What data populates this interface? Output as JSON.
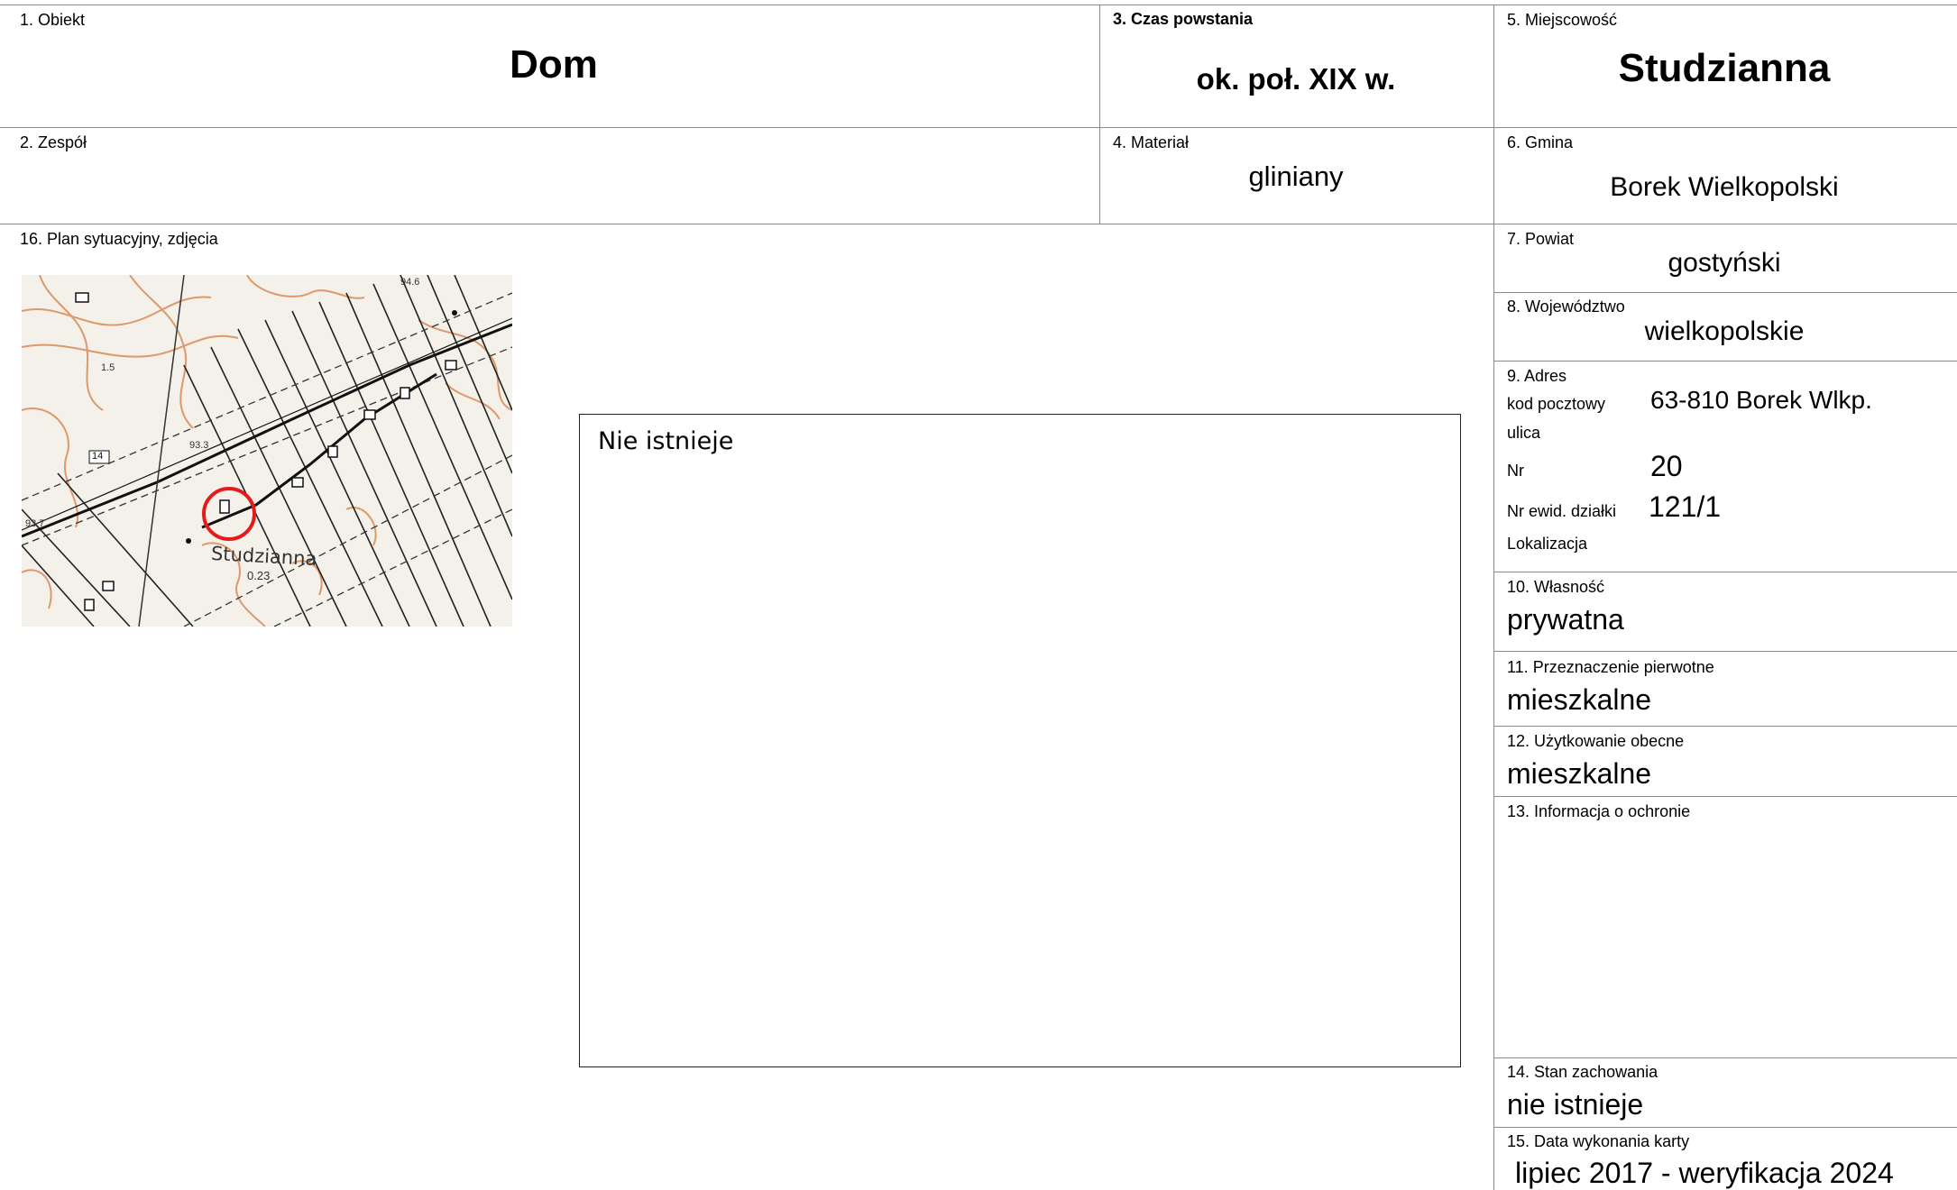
{
  "fields": {
    "obiekt": {
      "label": "1. Obiekt",
      "value": "Dom"
    },
    "zespol": {
      "label": "2. Zespół",
      "value": ""
    },
    "czas": {
      "label": "3. Czas powstania",
      "value": "ok. poł. XIX w."
    },
    "material": {
      "label": "4. Materiał",
      "value": "gliniany"
    },
    "miejscowosc": {
      "label": "5. Miejscowość",
      "value": "Studzianna"
    },
    "gmina": {
      "label": "6. Gmina",
      "value": "Borek Wielkopolski"
    },
    "powiat": {
      "label": "7. Powiat",
      "value": "gostyński"
    },
    "wojewodztwo": {
      "label": "8. Województwo",
      "value": "wielkopolskie"
    },
    "adres": {
      "label": "9. Adres",
      "kod_label": "kod pocztowy",
      "kod_value": "63-810 Borek Wlkp.",
      "ulica_label": "ulica",
      "ulica_value": "",
      "nr_label": "Nr",
      "nr_value": "20",
      "dzialka_label": "Nr ewid. działki",
      "dzialka_value": "121/1",
      "lokalizacja_label": "Lokalizacja",
      "lokalizacja_value": ""
    },
    "wlasnosc": {
      "label": "10. Własność",
      "value": "prywatna"
    },
    "przeznaczenie": {
      "label": "11. Przeznaczenie pierwotne",
      "value": "mieszkalne"
    },
    "uzytkowanie": {
      "label": "12. Użytkowanie obecne",
      "value": "mieszkalne"
    },
    "ochrona": {
      "label": "13. Informacja o ochronie",
      "value": ""
    },
    "stan": {
      "label": "14. Stan zachowania",
      "value": "nie istnieje"
    },
    "data": {
      "label": "15. Data wykonania karty",
      "value": "lipiec 2017 - weryfikacja 2024"
    },
    "plan": {
      "label": "16. Plan sytuacyjny, zdjęcia"
    }
  },
  "map": {
    "place_label": "Studzianna",
    "elevation_labels": [
      "0.23",
      "94.6",
      "93.3",
      "93.7",
      "1.5"
    ],
    "road_label": "14"
  },
  "photo": {
    "text": "Nie istnieje"
  }
}
